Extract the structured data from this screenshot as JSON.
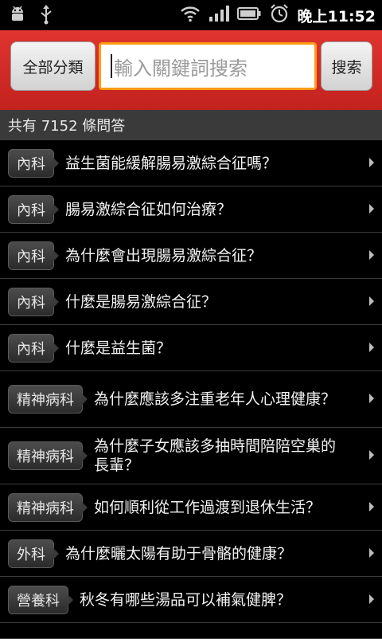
{
  "status_bar": {
    "time": "晚上11:52",
    "icons": [
      "android-debug-icon",
      "usb-icon",
      "wifi-icon",
      "signal-icon",
      "battery-icon",
      "alarm-icon"
    ]
  },
  "toolbar": {
    "category_label": "全部分類",
    "search_placeholder": "輸入關鍵詞搜索",
    "search_label": "搜索",
    "accent_color": "#d42a24",
    "focus_color": "#ff9b14"
  },
  "count_text": "共有 7152 條問答",
  "items": [
    {
      "category": "內科",
      "question": "益生菌能緩解腸易激綜合征嗎？"
    },
    {
      "category": "內科",
      "question": "腸易激綜合征如何治療？"
    },
    {
      "category": "內科",
      "question": "為什麼會出現腸易激綜合征？"
    },
    {
      "category": "內科",
      "question": "什麼是腸易激綜合征？"
    },
    {
      "category": "內科",
      "question": "什麼是益生菌？"
    },
    {
      "category": "精神病科",
      "question": "為什麼應該多注重老年人心理健康？"
    },
    {
      "category": "精神病科",
      "question": "為什麼子女應該多抽時間陪陪空巢的長輩？"
    },
    {
      "category": "精神病科",
      "question": "如何順利從工作過渡到退休生活？"
    },
    {
      "category": "外科",
      "question": "為什麼曬太陽有助于骨骼的健康？"
    },
    {
      "category": "營養科",
      "question": "秋冬有哪些湯品可以補氣健脾？"
    }
  ]
}
